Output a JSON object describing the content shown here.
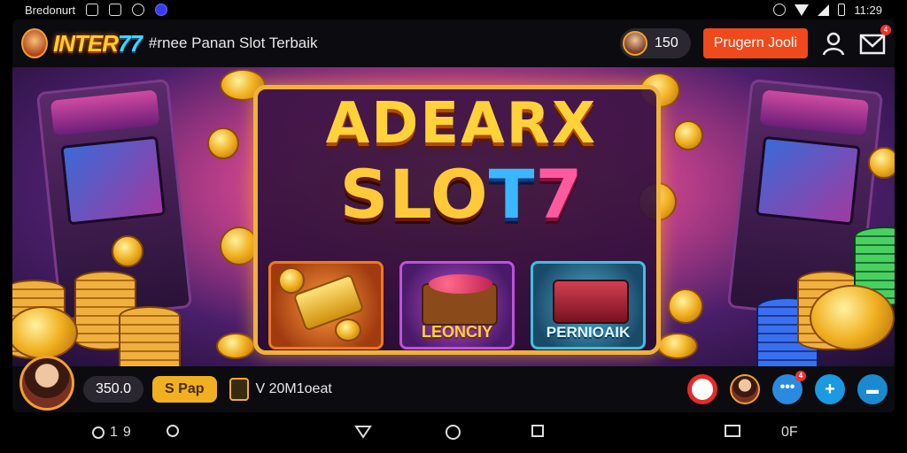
{
  "statusbar": {
    "carrier": "Bredonurt",
    "time": "11:29",
    "icons": [
      "notification-icon",
      "gallery-icon",
      "messenger-icon",
      "app-icon"
    ],
    "right_icons": [
      "alarm-icon",
      "wifi-icon",
      "signal-icon",
      "battery-icon"
    ]
  },
  "header": {
    "logo_text": "INTER",
    "logo_number": "77",
    "tagline": "#rnee Panan Slot Terbaik",
    "coin_balance": "150",
    "login_label": "Prugern Jooli",
    "mail_badge": "4"
  },
  "hero": {
    "title_line1": "ADEARX",
    "title_line2_a": "SLO",
    "title_line2_b": "T",
    "title_line2_c": "7",
    "tiles": [
      {
        "label": "",
        "icon": "gold-bar-icon"
      },
      {
        "label": "LEONCIY",
        "icon": "gem-box-icon"
      },
      {
        "label": "PERNIOAIK",
        "icon": "chest-icon"
      }
    ],
    "cabinet_signs": [
      "",
      ""
    ]
  },
  "footer": {
    "balance": "350.0",
    "spin_label": "S Pap",
    "ticket_text": "V 20M1oeat",
    "chat_badge": "4"
  },
  "navbar": {
    "left_a": "1",
    "left_b": "9",
    "right_text": "0F"
  },
  "colors": {
    "accent_orange": "#f04a1c",
    "gold": "#ffd23a",
    "panel_border": "#f0b23a"
  }
}
